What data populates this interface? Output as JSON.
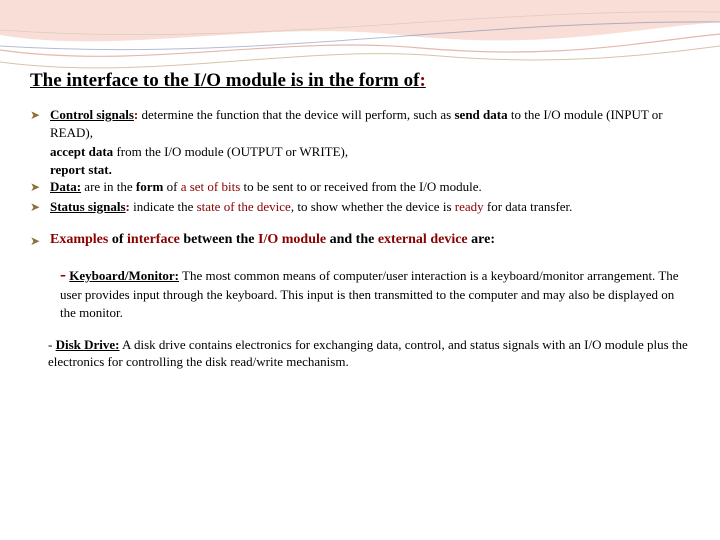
{
  "title": "The interface to the I/O module is in the form of",
  "title_colon": ":",
  "b1": {
    "term": "Control signals",
    "colon": ":",
    "t1": "determine the function that the device will perform, such as ",
    "t2": "send data",
    "t3": " to the I/O module (INPUT or READ),",
    "l2a": "accept data",
    "l2b": " from the I/O module (OUTPUT or WRITE),",
    "l3": "report stat."
  },
  "b2": {
    "term": "Data:",
    "t1": " are in the ",
    "t2": "form",
    "t3": " of ",
    "t4": "a set of bits",
    "t5": " to be sent to or received from the I/O module."
  },
  "b3": {
    "term": "Status signals",
    "colon": ":",
    "t1": " indicate the ",
    "t2": "state of the device",
    "t3": ", to show whether the device is ",
    "t4": "ready",
    "t5": " for data transfer."
  },
  "ex": {
    "p1": "Examples",
    "p2": " of ",
    "p3": "interface",
    "p4": " between the ",
    "p5": "I/O module",
    "p6": " and the ",
    "p7": "external device",
    "p8": " are:"
  },
  "km": {
    "dash": "-",
    "title": "Keyboard/Monitor:",
    "text": " The most common means of computer/user interaction is a keyboard/monitor arrangement. The user provides input through the keyboard. This input is then transmitted to the computer and may also be displayed on the monitor."
  },
  "dd": {
    "dash": "- ",
    "title": "Disk Drive:",
    "text": " A disk drive contains electronics for exchanging data, control, and status signals with an I/O module plus the electronics for controlling the disk read/write mechanism."
  }
}
